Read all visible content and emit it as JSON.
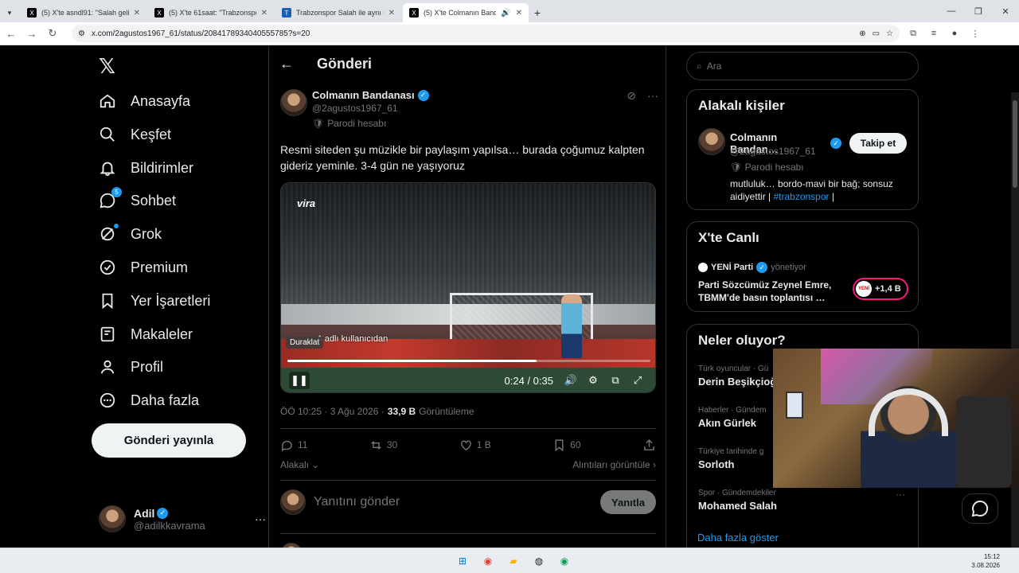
{
  "browser": {
    "tabs": [
      {
        "title": "(5) X'te asndl91: \"Salah gelirse il",
        "active": false,
        "favicon": "x"
      },
      {
        "title": "(5) X'te 61saat: \"Trabzonspor Sa",
        "active": false,
        "favicon": "x"
      },
      {
        "title": "Trabzonspor Salah ile aynı uçak",
        "active": false,
        "favicon": "ts"
      },
      {
        "title": "(5) X'te Colmanın Bandana",
        "active": true,
        "favicon": "x"
      }
    ],
    "url": "x.com/2agustos1967_61/status/2084178934040555785?s=20"
  },
  "nav": {
    "items": [
      {
        "label": "Anasayfa",
        "icon": "home-icon"
      },
      {
        "label": "Keşfet",
        "icon": "search-icon"
      },
      {
        "label": "Bildirimler",
        "icon": "bell-icon"
      },
      {
        "label": "Sohbet",
        "icon": "chat-icon",
        "badge": "5"
      },
      {
        "label": "Grok",
        "icon": "grok-icon"
      },
      {
        "label": "Premium",
        "icon": "premium-icon"
      },
      {
        "label": "Yer İşaretleri",
        "icon": "bookmark-icon"
      },
      {
        "label": "Makaleler",
        "icon": "article-icon"
      },
      {
        "label": "Profil",
        "icon": "profile-icon"
      },
      {
        "label": "Daha fazla",
        "icon": "more-icon"
      }
    ],
    "post_button": "Gönderi yayınla",
    "account": {
      "name": "Adil",
      "handle": "@adilkkavrama"
    }
  },
  "main": {
    "title": "Gönderi",
    "author": {
      "name": "Colmanın Bandanası",
      "handle": "@2agustos1967_61",
      "label": "Parodi hesabı"
    },
    "text": "Resmi siteden şu müzikle bir paylaşım yapılsa… burada çoğumuz kalpten gideriz yeminle. 3-4 gün ne yaşıyoruz",
    "video": {
      "watermark": "vira",
      "caption": "A adlı kullanıcıdan",
      "tooltip": "Duraklat",
      "time": "0:24 / 0:35",
      "progress": 0.686
    },
    "meta": {
      "time": "ÖÖ 10:25 · 3 Ağu 2026 ·",
      "views": "33,9 B",
      "views_label": "Görüntüleme"
    },
    "stats": {
      "replies": "11",
      "reposts": "30",
      "likes": "1 B",
      "bookmarks": "60"
    },
    "relevance": "Alakalı",
    "quotes_link": "Alıntıları görüntüle",
    "reply_placeholder": "Yanıtını gönder",
    "reply_button": "Yanıtla"
  },
  "right": {
    "search_placeholder": "Ara",
    "related_title": "Alakalı kişiler",
    "related_person": {
      "name": "Colmanın Bandan…",
      "handle": "@2agustos1967_61",
      "label": "Parodi hesabı",
      "bio": "mutluluk… bordo-mavi bir bağ; sonsuz aidiyettir |",
      "hashtag": "#trabzonspor",
      "bio_end": "|",
      "follow": "Takip et"
    },
    "live_title": "X'te Canlı",
    "live": {
      "host": "YENİ Parti",
      "host_suffix": "yönetiyor",
      "title": "Parti Sözcümüz Zeynel Emre, TBMM'de basın toplantısı …",
      "badge_logo": "YENİ",
      "count": "+1,4 B"
    },
    "trends_title": "Neler oluyor?",
    "trends": [
      {
        "context": "Türk oyuncular · Gü",
        "name": "Derin Beşikçioğ"
      },
      {
        "context": "Haberler · Gündem",
        "name": "Akın Gürlek"
      },
      {
        "context": "Türkiye tarihinde g",
        "name": "Sorloth"
      },
      {
        "context": "Spor · Gündemdekiler",
        "name": "Mohamed Salah"
      }
    ],
    "show_more": "Daha fazla göster"
  },
  "taskbar": {
    "time": "15:12",
    "date": "3.08.2026"
  }
}
